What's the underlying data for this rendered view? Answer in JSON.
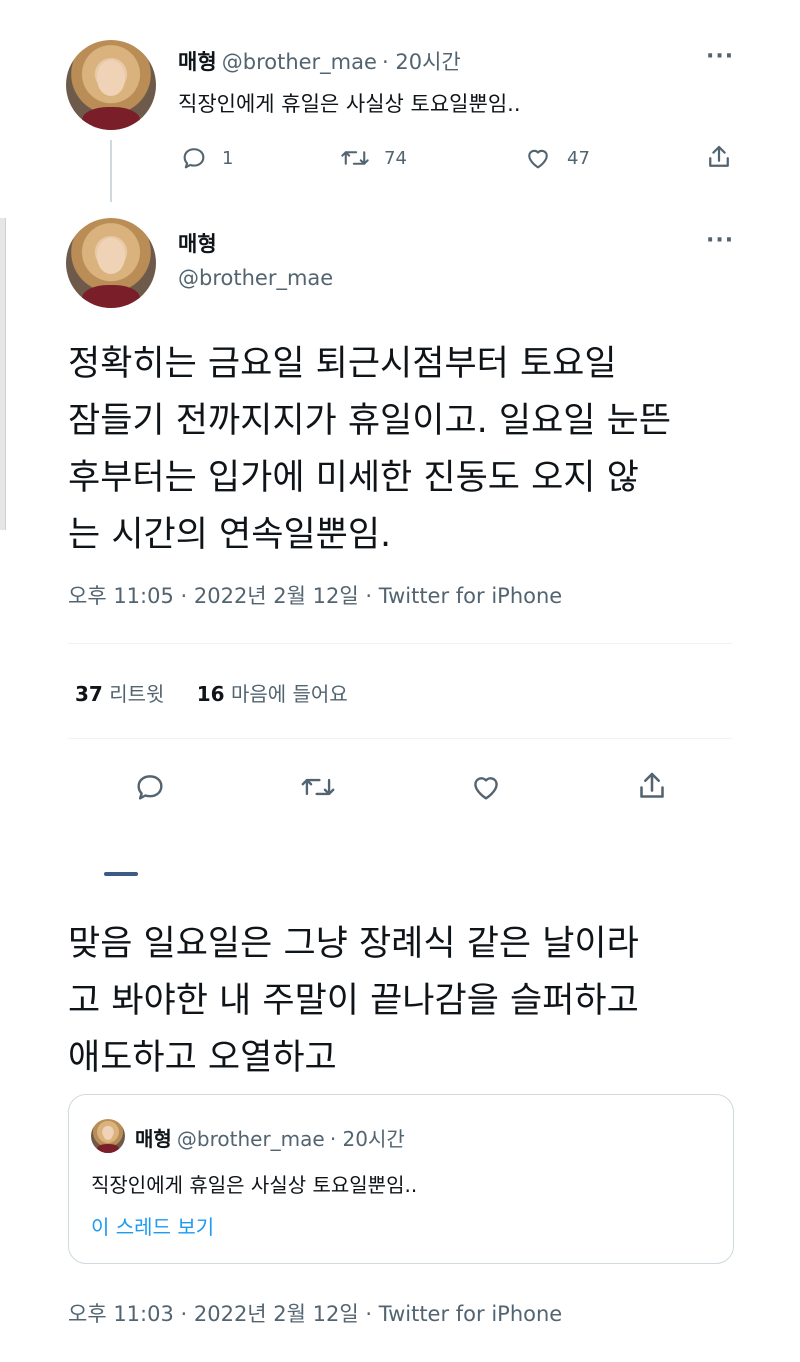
{
  "tweet1": {
    "name": "매형",
    "handle": "@brother_mae",
    "time": "· 20시간",
    "text": "직장인에게 휴일은 사실상 토요일뿐임..",
    "replies": "1",
    "retweets": "74",
    "likes": "47"
  },
  "tweet2": {
    "name": "매형",
    "handle": "@brother_mae",
    "text_lines": [
      "정확히는 금요일 퇴근시점부터 토요일",
      "잠들기 전까지지가 휴일이고. 일요일 눈뜬",
      "후부터는 입가에 미세한 진동도 오지 않",
      "는 시간의 연속일뿐임."
    ],
    "meta": "오후 11:05 · 2022년 2월 12일 · Twitter for iPhone",
    "retweet_count": "37",
    "retweet_label": "리트윗",
    "like_count": "16",
    "like_label": "마음에 들어요"
  },
  "tweet3": {
    "text_lines": [
      "맞음 일요일은 그냥 장례식 같은 날이라",
      "고 봐야한 내 주말이 끝나감을 슬퍼하고",
      "애도하고 오열하고"
    ],
    "quote": {
      "name": "매형",
      "handle": "@brother_mae",
      "time": "· 20시간",
      "text": "직장인에게 휴일은 사실상 토요일뿐임..",
      "link": "이 스레드 보기"
    },
    "meta": "오후 11:03 · 2022년 2월 12일 · Twitter for iPhone"
  },
  "more_label": "···"
}
